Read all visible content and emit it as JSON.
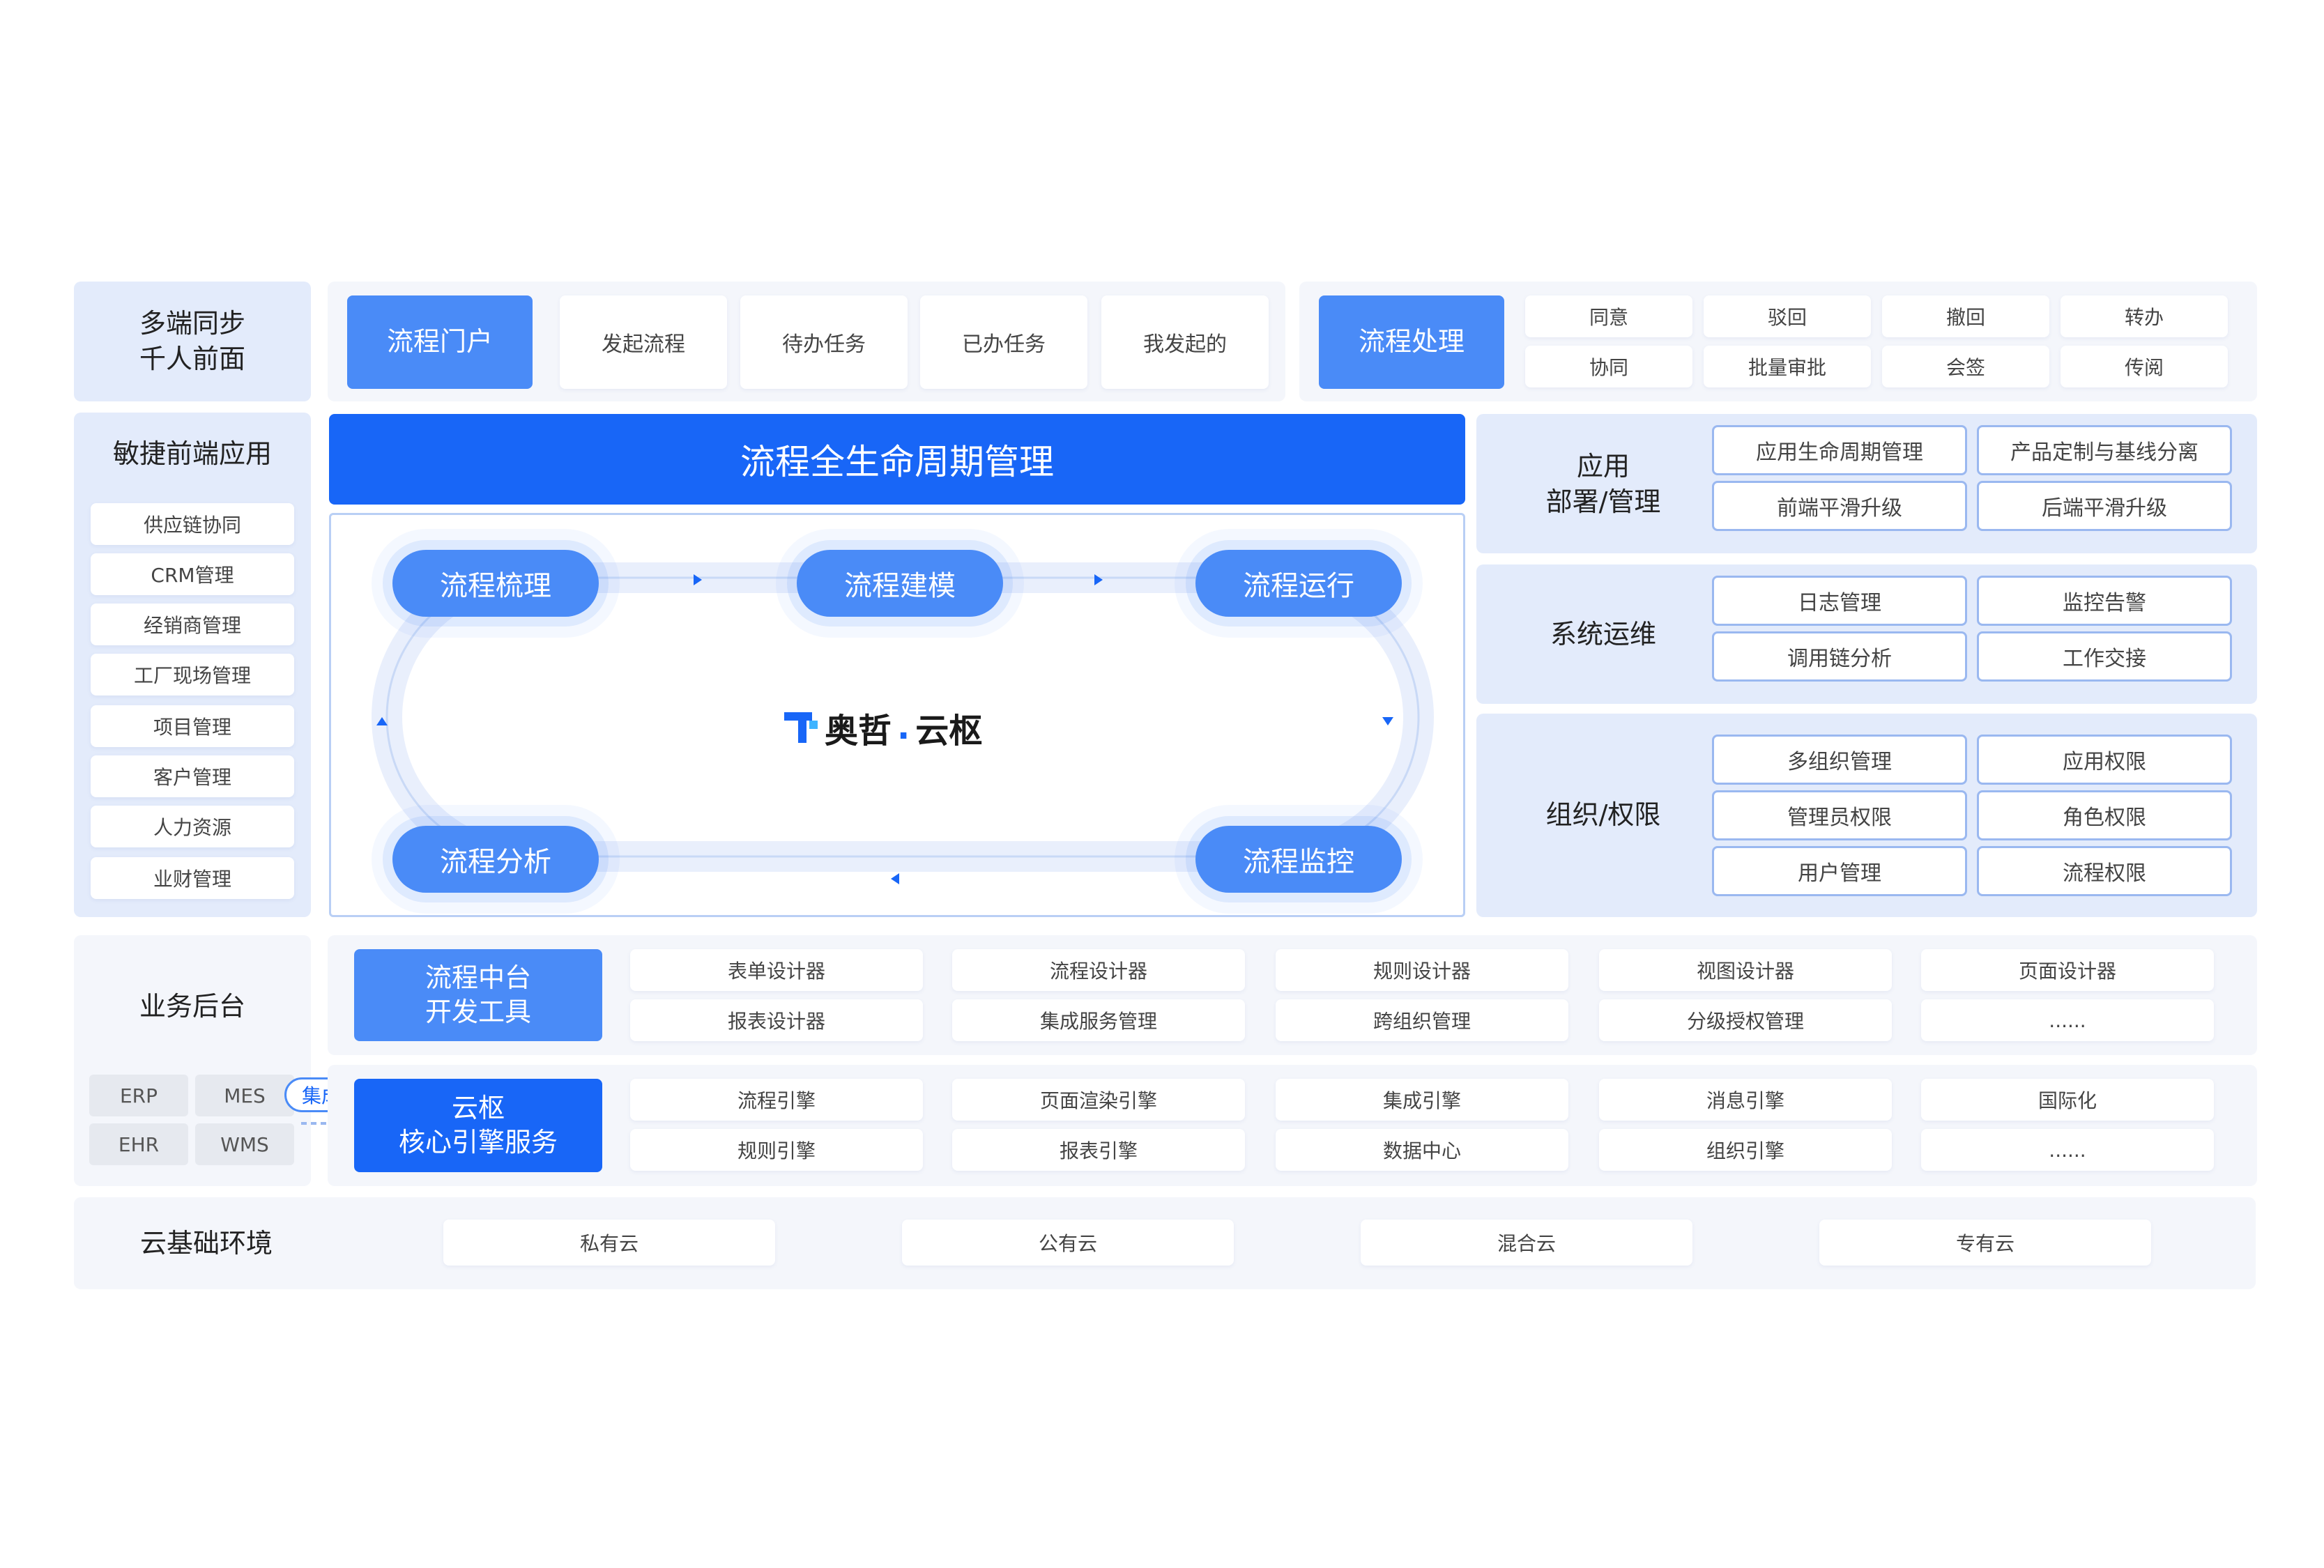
{
  "row1": {
    "left_label": "多端同步\n千人前面",
    "portal_button": "流程门户",
    "portal_items": [
      "发起流程",
      "待办任务",
      "已办任务",
      "我发起的"
    ],
    "process_button": "流程处理",
    "process_items": [
      "同意",
      "驳回",
      "撤回",
      "转办",
      "协同",
      "批量审批",
      "会签",
      "传阅"
    ]
  },
  "agile": {
    "title": "敏捷前端应用",
    "items": [
      "供应链协同",
      "CRM管理",
      "经销商管理",
      "工厂现场管理",
      "项目管理",
      "客户管理",
      "人力资源",
      "业财管理"
    ]
  },
  "lifecycle": {
    "header": "流程全生命周期管理",
    "stages": [
      "流程梳理",
      "流程建模",
      "流程运行",
      "流程监控",
      "流程分析"
    ],
    "logo_text": "奥哲",
    "logo_dot": ".",
    "logo_suffix": "云枢"
  },
  "right": {
    "deploy_label": "应用\n部署/管理",
    "deploy_items": [
      "应用生命周期管理",
      "产品定制与基线分离",
      "前端平滑升级",
      "后端平滑升级"
    ],
    "ops_label": "系统运维",
    "ops_items": [
      "日志管理",
      "监控告警",
      "调用链分析",
      "工作交接"
    ],
    "org_label": "组织/权限",
    "org_items": [
      "多组织管理",
      "应用权限",
      "管理员权限",
      "角色权限",
      "用户管理",
      "流程权限"
    ]
  },
  "backend": {
    "label": "业务后台",
    "systems": [
      "ERP",
      "MES",
      "EHR",
      "WMS"
    ],
    "integrate_badge": "集成",
    "dev_button": "流程中台\n开发工具",
    "dev_items": [
      "表单设计器",
      "流程设计器",
      "规则设计器",
      "视图设计器",
      "页面设计器",
      "报表设计器",
      "集成服务管理",
      "跨组织管理",
      "分级授权管理",
      "......"
    ],
    "engine_button": "云枢\n核心引擎服务",
    "engine_items": [
      "流程引擎",
      "页面渲染引擎",
      "集成引擎",
      "消息引擎",
      "国际化",
      "规则引擎",
      "报表引擎",
      "数据中心",
      "组织引擎",
      "......"
    ]
  },
  "cloud": {
    "label": "云基础环境",
    "items": [
      "私有云",
      "公有云",
      "混合云",
      "专有云"
    ]
  },
  "colors": {
    "primary": "#1866f7",
    "accent": "#4a8bf7",
    "panel": "#f4f6fb",
    "panel_blue": "#e3ebfb"
  }
}
